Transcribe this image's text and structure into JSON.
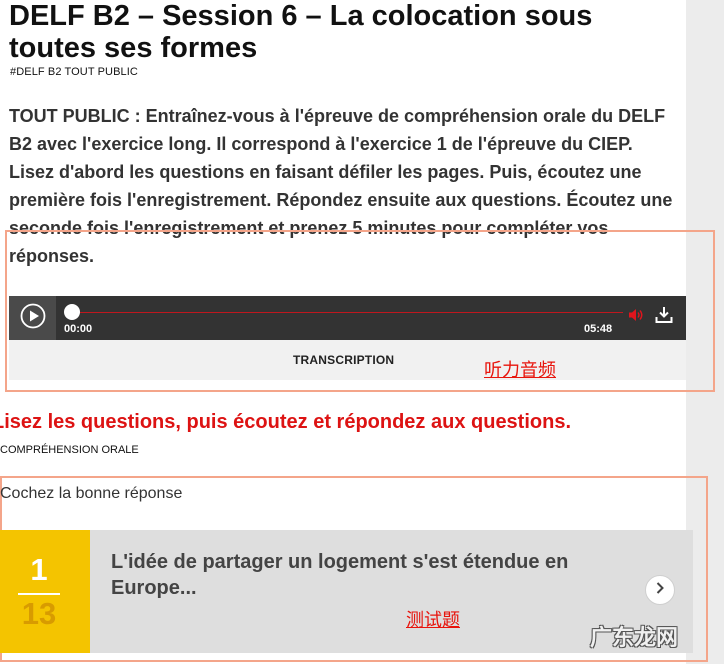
{
  "article": {
    "title": "DELF B2 – Session 6 – La colocation sous toutes ses formes",
    "tag": "#DELF B2 TOUT PUBLIC",
    "intro": "TOUT PUBLIC : Entraînez-vous à l'épreuve de compréhension orale du DELF B2 avec l'exercice long. Il correspond à l'exercice 1 de l'épreuve du CIEP. Lisez d'abord les questions en faisant défiler les pages. Puis, écoutez une première fois l'enregistrement. Répondez ensuite aux questions. Écoutez une seconde fois l'enregistrement et prenez 5 minutes pour compléter vos réponses."
  },
  "player": {
    "current_time": "00:00",
    "total_time": "05:48",
    "progress": 0,
    "transcription_label": "TRANSCRIPTION",
    "icons": [
      "play-icon",
      "volume-icon",
      "download-icon"
    ],
    "accent_color": "#c0171e"
  },
  "annotations": {
    "audio_label": "听力音频",
    "quiz_label": "测试题",
    "color": "#e8140c"
  },
  "exercise": {
    "heading": "Lisez les questions, puis écoutez et répondez aux questions.",
    "section_label": "COMPRÉHENSION ORALE",
    "instruction": "Cochez la bonne réponse",
    "question_number": "1",
    "question_total": "13",
    "question_text": "L'idée de partager un logement s'est étendue en Europe...",
    "number_color": "#f4c400"
  },
  "watermark": "广东龙网"
}
